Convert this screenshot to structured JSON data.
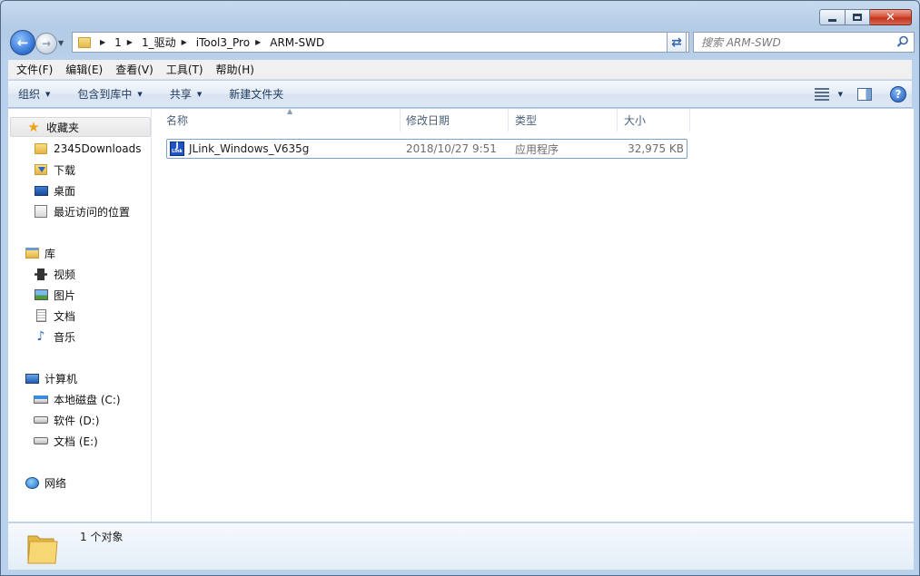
{
  "window": {
    "caption_buttons": [
      "minimize",
      "maximize",
      "close"
    ]
  },
  "address": {
    "path": [
      "1",
      "1_驱动",
      "iTool3_Pro",
      "ARM-SWD"
    ]
  },
  "search": {
    "placeholder": "搜索 ARM-SWD"
  },
  "menu": [
    "文件(F)",
    "编辑(E)",
    "查看(V)",
    "工具(T)",
    "帮助(H)"
  ],
  "toolbar": {
    "organize": "组织",
    "include_library": "包含到库中",
    "share": "共享",
    "new_folder": "新建文件夹"
  },
  "sidebar": {
    "favorites": {
      "label": "收藏夹",
      "items": [
        "2345Downloads",
        "下载",
        "桌面",
        "最近访问的位置"
      ]
    },
    "libraries": {
      "label": "库",
      "items": [
        "视频",
        "图片",
        "文档",
        "音乐"
      ]
    },
    "computer": {
      "label": "计算机",
      "items": [
        "本地磁盘 (C:)",
        "软件 (D:)",
        "文档 (E:)"
      ]
    },
    "network": {
      "label": "网络"
    }
  },
  "columns": {
    "name": "名称",
    "date": "修改日期",
    "type": "类型",
    "size": "大小"
  },
  "files": [
    {
      "name": "JLink_Windows_V635g",
      "date": "2018/10/27 9:51",
      "type": "应用程序",
      "size": "32,975 KB"
    }
  ],
  "status": {
    "count": "1 个对象"
  }
}
